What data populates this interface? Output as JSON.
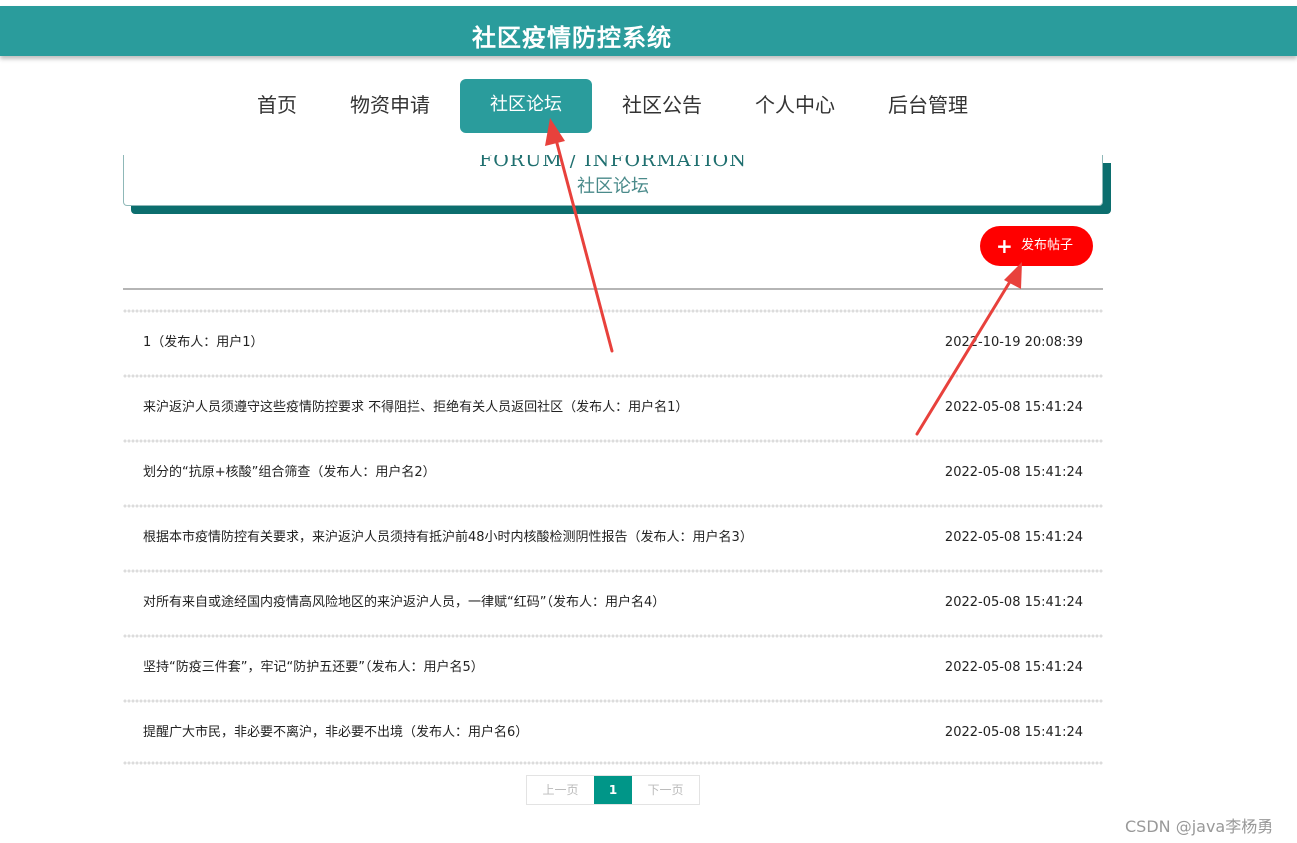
{
  "header": {
    "title": "社区疫情防控系统"
  },
  "nav": {
    "items": [
      {
        "label": "首页"
      },
      {
        "label": "物资申请"
      },
      {
        "label": "社区论坛",
        "active": true
      },
      {
        "label": "社区公告"
      },
      {
        "label": "个人中心"
      },
      {
        "label": "后台管理"
      }
    ]
  },
  "hero": {
    "title_en": "FORUM / INFORMATION",
    "title_cn": "社区论坛"
  },
  "publish_button": {
    "label": "发布帖子",
    "icon": "plus-icon"
  },
  "posts": [
    {
      "title": "1（发布人：用户1）",
      "time": "2022-10-19 20:08:39"
    },
    {
      "title": "来沪返沪人员须遵守这些疫情防控要求 不得阻拦、拒绝有关人员返回社区（发布人：用户名1）",
      "time": "2022-05-08 15:41:24"
    },
    {
      "title": "划分的“抗原+核酸”组合筛查（发布人：用户名2）",
      "time": "2022-05-08 15:41:24"
    },
    {
      "title": "根据本市疫情防控有关要求，来沪返沪人员须持有抵沪前48小时内核酸检测阴性报告（发布人：用户名3）",
      "time": "2022-05-08 15:41:24"
    },
    {
      "title": "对所有来自或途经国内疫情高风险地区的来沪返沪人员，一律赋“红码”（发布人：用户名4）",
      "time": "2022-05-08 15:41:24"
    },
    {
      "title": "坚持“防疫三件套”，牢记“防护五还要”（发布人：用户名5）",
      "time": "2022-05-08 15:41:24"
    },
    {
      "title": "提醒广大市民，非必要不离沪，非必要不出境（发布人：用户名6）",
      "time": "2022-05-08 15:41:24"
    }
  ],
  "pagination": {
    "prev": "上一页",
    "current": "1",
    "next": "下一页"
  },
  "watermark": "CSDN @java李杨勇",
  "colors": {
    "primary": "#2a9c9c",
    "accent": "#ff0000",
    "annotation_arrow": "#e8413c"
  }
}
